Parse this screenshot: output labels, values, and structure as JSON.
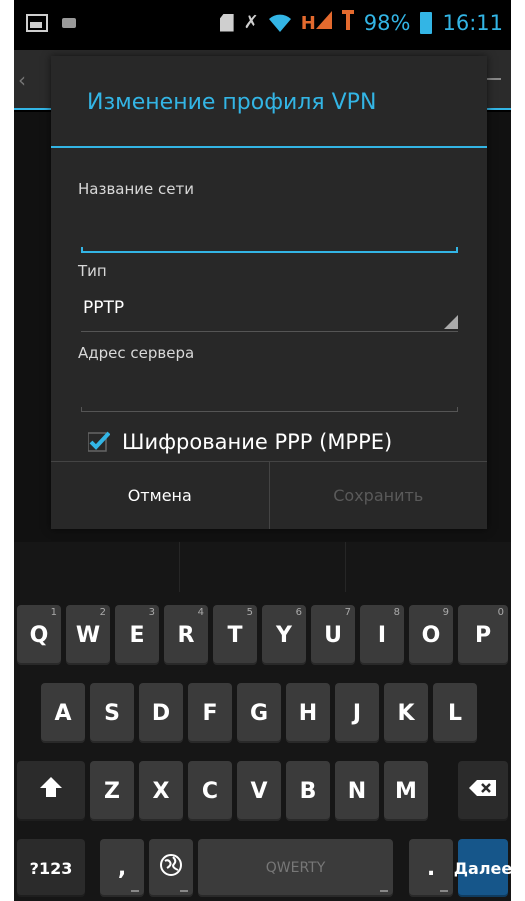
{
  "status_bar": {
    "icons": [
      "picture-icon",
      "usb-icon",
      "sd-card-icon",
      "mute-icon",
      "wifi-icon",
      "ht-signal-icon",
      "roaming-signal-icon",
      "battery-icon"
    ],
    "battery": "98%",
    "time": "16:11",
    "network_label": "H"
  },
  "dialog": {
    "title": "Изменение профиля VPN",
    "name_label": "Название сети",
    "name_value": "",
    "type_label": "Тип",
    "type_value": "PPTP",
    "server_label": "Адрес сервера",
    "server_value": "",
    "encryption_label": "Шифрование PPP (MPPE)",
    "encryption_checked": true,
    "cancel": "Отмена",
    "save": "Сохранить"
  },
  "keyboard": {
    "row1": [
      {
        "label": "Q",
        "hint": "1"
      },
      {
        "label": "W",
        "hint": "2"
      },
      {
        "label": "E",
        "hint": "3"
      },
      {
        "label": "R",
        "hint": "4"
      },
      {
        "label": "T",
        "hint": "5"
      },
      {
        "label": "Y",
        "hint": "6"
      },
      {
        "label": "U",
        "hint": "7"
      },
      {
        "label": "I",
        "hint": "8"
      },
      {
        "label": "O",
        "hint": "9"
      },
      {
        "label": "P",
        "hint": "0"
      }
    ],
    "row2": [
      "A",
      "S",
      "D",
      "F",
      "G",
      "H",
      "J",
      "K",
      "L"
    ],
    "row3": [
      "Z",
      "X",
      "C",
      "V",
      "B",
      "N",
      "M"
    ],
    "symbols": "?123",
    "comma": ",",
    "space": "QWERTY",
    "period": ".",
    "done": "Далее",
    "shift_icon": "shift-icon",
    "delete_icon": "backspace-icon",
    "globe_icon": "globe-icon"
  },
  "colors": {
    "accent": "#33b5e5",
    "dialog_bg": "#282828",
    "key_bg": "#3b3b3b",
    "done_bg": "#16568a"
  }
}
